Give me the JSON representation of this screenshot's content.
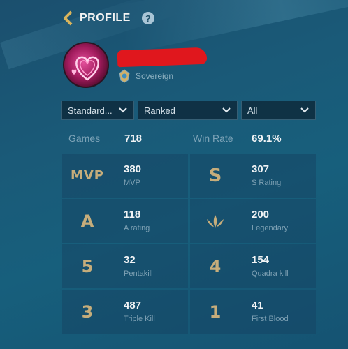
{
  "header": {
    "title": "PROFILE",
    "help": "?"
  },
  "profile": {
    "rank_name": "Sovereign"
  },
  "filters": [
    {
      "label": "Standard..."
    },
    {
      "label": "Ranked"
    },
    {
      "label": "All"
    }
  ],
  "summary": {
    "games_label": "Games",
    "games_value": "718",
    "winrate_label": "Win Rate",
    "winrate_value": "69.1%"
  },
  "stats": [
    {
      "icon": "MVP",
      "value": "380",
      "label": "MVP"
    },
    {
      "icon": "S",
      "value": "307",
      "label": "S Rating"
    },
    {
      "icon": "A",
      "value": "118",
      "label": "A rating"
    },
    {
      "icon": "legendary-icon",
      "value": "200",
      "label": "Legendary"
    },
    {
      "icon": "5",
      "value": "32",
      "label": "Pentakill"
    },
    {
      "icon": "4",
      "value": "154",
      "label": "Quadra kill"
    },
    {
      "icon": "3",
      "value": "487",
      "label": "Triple Kill"
    },
    {
      "icon": "1",
      "value": "41",
      "label": "First Blood"
    }
  ]
}
